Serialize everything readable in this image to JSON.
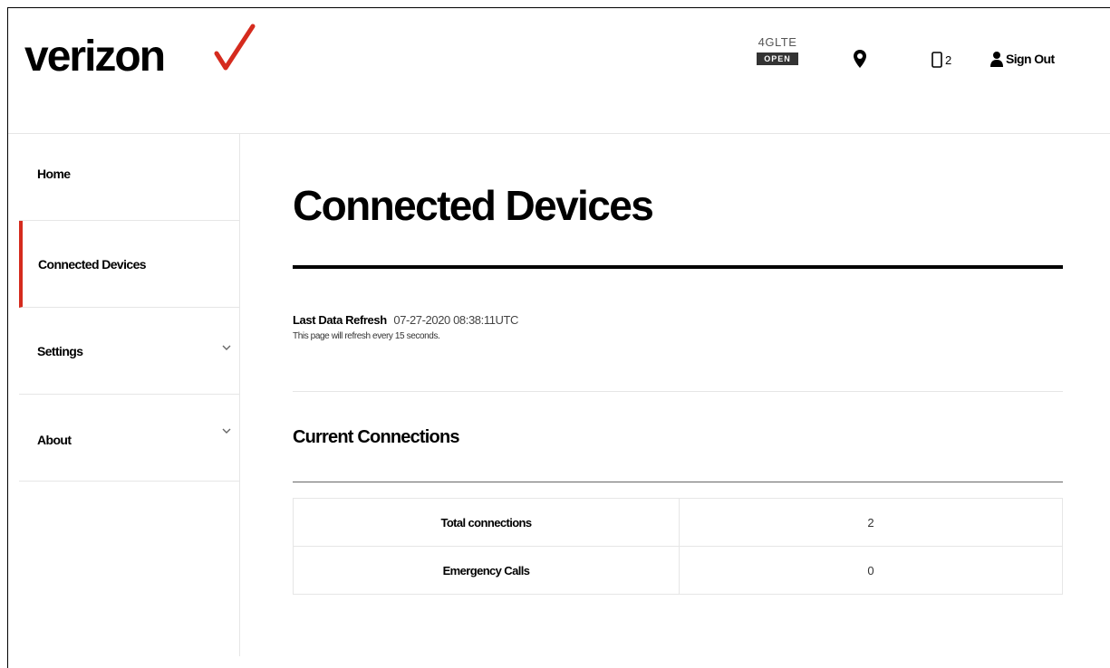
{
  "header": {
    "logo_text": "verizon",
    "network": {
      "type": "4GLTE",
      "status_badge": "OPEN"
    },
    "icons": {
      "location": "location-pin-icon",
      "device": "device-phone-icon",
      "user": "user-icon"
    },
    "device_count": "2",
    "sign_out_label": "Sign Out"
  },
  "sidebar": {
    "items": [
      {
        "label": "Home",
        "active": false,
        "expandable": false
      },
      {
        "label": "Connected Devices",
        "active": true,
        "expandable": false
      },
      {
        "label": "Settings",
        "active": false,
        "expandable": true
      },
      {
        "label": "About",
        "active": false,
        "expandable": true
      }
    ]
  },
  "main": {
    "title": "Connected Devices",
    "last_refresh_label": "Last Data Refresh",
    "last_refresh_value": "07-27-2020 08:38:11UTC",
    "refresh_note": "This page will refresh every 15 seconds.",
    "section_title": "Current Connections",
    "table": {
      "rows": [
        {
          "name": "Total connections",
          "value": "2"
        },
        {
          "name": "Emergency Calls",
          "value": "0"
        }
      ]
    }
  },
  "colors": {
    "brand_red": "#d52b1e",
    "badge_bg": "#333333",
    "divider": "#e6e6e6"
  }
}
